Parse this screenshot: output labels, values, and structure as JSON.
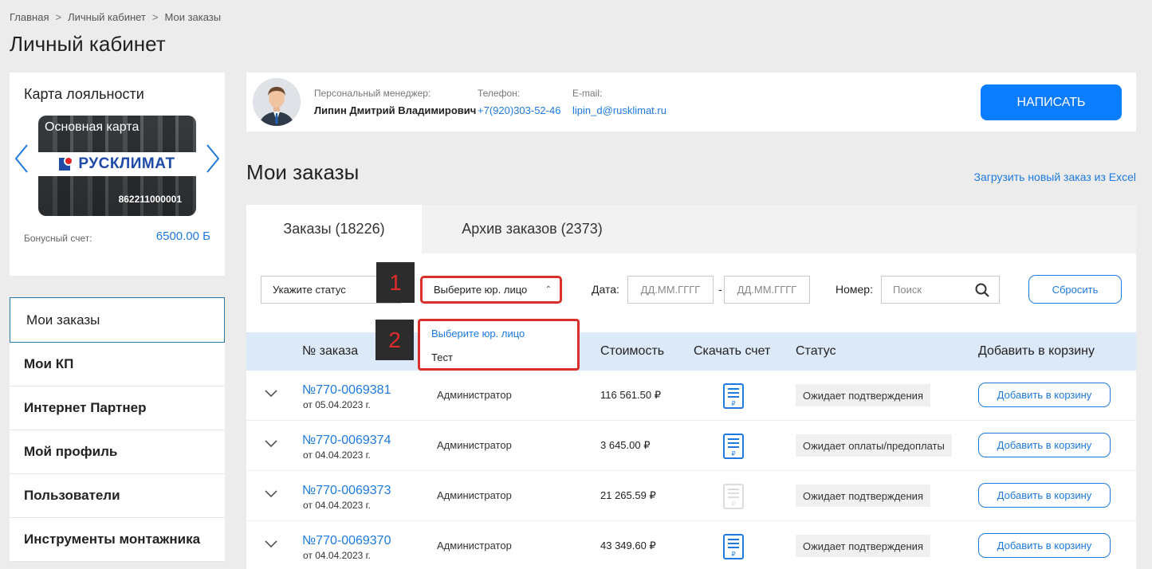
{
  "breadcrumb": {
    "items": [
      "Главная",
      "Личный кабинет",
      "Мои заказы"
    ],
    "separator": ">"
  },
  "page_title": "Личный кабинет",
  "loyalty": {
    "title": "Карта лояльности",
    "card_name": "Основная карта",
    "card_brand": "РУСКЛИМАТ",
    "card_number": "862211000001",
    "bonus_label": "Бонусный счет:",
    "bonus_value": "6500.00 Б"
  },
  "menu": {
    "items": [
      {
        "label": "Мои заказы",
        "active": true
      },
      {
        "label": "Мои КП"
      },
      {
        "label": "Интернет Партнер"
      },
      {
        "label": "Мой профиль"
      },
      {
        "label": "Пользователи"
      },
      {
        "label": "Инструменты монтажника"
      }
    ]
  },
  "manager": {
    "role_label": "Персональный менеджер:",
    "name": "Липин Дмитрий Владимирович",
    "phone_label": "Телефон:",
    "phone": "+7(920)303-52-46",
    "email_label": "E-mail:",
    "email": "lipin_d@rusklimat.ru",
    "write_button": "НАПИСАТЬ"
  },
  "orders": {
    "title": "Мои заказы",
    "excel_link": "Загрузить новый заказ из Excel",
    "tabs": [
      {
        "label": "Заказы (18226)",
        "active": true
      },
      {
        "label": "Архив заказов (2373)"
      }
    ]
  },
  "filters": {
    "status_placeholder": "Укажите статус",
    "entity_placeholder": "Выберите юр. лицо",
    "date_label": "Дата:",
    "date_from_placeholder": "ДД.ММ.ГГГГ",
    "date_to_placeholder": "ДД.ММ.ГГГГ",
    "date_separator": "-",
    "number_label": "Номер:",
    "search_placeholder": "Поиск",
    "reset_button": "Сбросить"
  },
  "entity_dropdown": {
    "options": [
      "Выберите юр. лицо",
      "Тест"
    ],
    "selected_index": 0
  },
  "markers": [
    "1",
    "2"
  ],
  "table": {
    "headers": {
      "number": "№ заказа",
      "cost": "Стоимость",
      "invoice": "Скачать счет",
      "status": "Статус",
      "cart": "Добавить в корзину"
    },
    "rows": [
      {
        "number": "№770-0069381",
        "date": "от 05.04.2023 г.",
        "creator": "Администратор",
        "cost": "116 561.50 ₽",
        "invoice_available": true,
        "status": "Ожидает подтверждения",
        "cart_button": "Добавить в корзину"
      },
      {
        "number": "№770-0069374",
        "date": "от 04.04.2023 г.",
        "creator": "Администратор",
        "cost": "3 645.00 ₽",
        "invoice_available": true,
        "status": "Ожидает оплаты/предоплаты",
        "cart_button": "Добавить в корзину"
      },
      {
        "number": "№770-0069373",
        "date": "от 04.04.2023 г.",
        "creator": "Администратор",
        "cost": "21 265.59 ₽",
        "invoice_available": false,
        "status": "Ожидает подтверждения",
        "cart_button": "Добавить в корзину"
      },
      {
        "number": "№770-0069370",
        "date": "от 04.04.2023 г.",
        "creator": "Администратор",
        "cost": "43 349.60 ₽",
        "invoice_available": true,
        "status": "Ожидает подтверждения",
        "cart_button": "Добавить в корзину"
      }
    ]
  },
  "colors": {
    "accent": "#1e7ae0",
    "button": "#0a7cff",
    "highlight": "#d9302c",
    "table_header": "#dbe9f8"
  }
}
